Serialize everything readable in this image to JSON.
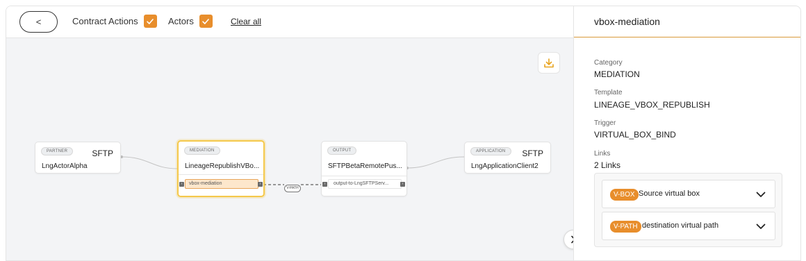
{
  "toolbar": {
    "back_label": "<",
    "filters": [
      {
        "label": "Contract Actions",
        "checked": true
      },
      {
        "label": "Actors",
        "checked": true
      }
    ],
    "clear_all_label": "Clear all"
  },
  "nodes": {
    "partner": {
      "tag": "PARTNER",
      "protocol": "SFTP",
      "name": "LngActorAlpha"
    },
    "mediation": {
      "tag": "MEDIATION",
      "name": "LineageRepublishVBo...",
      "vbox": "vbox-mediation"
    },
    "output": {
      "tag": "OUTPUT",
      "name": "SFTPBetaRemotePus...",
      "port": "output-to-LngSFTPServ..."
    },
    "application": {
      "tag": "APPLICATION",
      "protocol": "SFTP",
      "name": "LngApplicationClient2"
    }
  },
  "edge": {
    "vpath_label": "V-PATH"
  },
  "details": {
    "title": "vbox-mediation",
    "category_label": "Category",
    "category_value": "MEDIATION",
    "template_label": "Template",
    "template_value": "LINEAGE_VBOX_REPUBLISH",
    "trigger_label": "Trigger",
    "trigger_value": "VIRTUAL_BOX_BIND",
    "links_label": "Links",
    "links_count": "2 Links",
    "links": [
      {
        "badge": "V-BOX",
        "text": "Source virtual box"
      },
      {
        "badge": "V-PATH",
        "text": "destination virtual path"
      }
    ]
  },
  "colors": {
    "accent": "#e88e2c",
    "selected_border": "#f5c84a",
    "canvas_bg": "#f3f4f6"
  },
  "icons": [
    "download-icon",
    "chevron-right-icon",
    "chevron-down-icon",
    "check-icon"
  ]
}
